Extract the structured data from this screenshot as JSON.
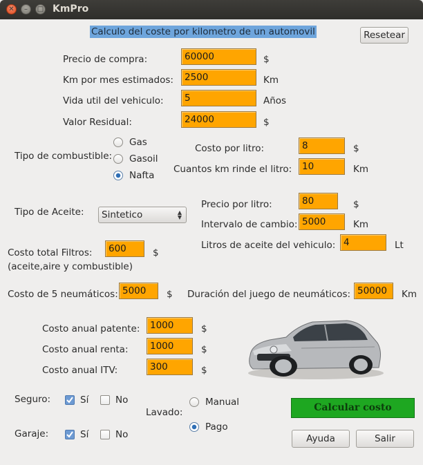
{
  "window": {
    "title": "KmPro"
  },
  "header": {
    "heading": "Calculo del coste por kilometro de un automovil",
    "reset_label": "Resetear"
  },
  "vehicle": {
    "precio_compra": {
      "label": "Precio de compra:",
      "value": "60000",
      "unit": "$"
    },
    "km_mes": {
      "label": "Km por mes estimados:",
      "value": "2500",
      "unit": "Km"
    },
    "vida_util": {
      "label": "Vida util del vehiculo:",
      "value": "5",
      "unit": "Años"
    },
    "valor_residual": {
      "label": "Valor Residual:",
      "value": "24000",
      "unit": "$"
    }
  },
  "fuel": {
    "label": "Tipo de combustible:",
    "options": [
      {
        "label": "Gas",
        "selected": false
      },
      {
        "label": "Gasoil",
        "selected": false
      },
      {
        "label": "Nafta",
        "selected": true
      }
    ],
    "costo_litro": {
      "label": "Costo por litro:",
      "value": "8",
      "unit": "$"
    },
    "km_litro": {
      "label": "Cuantos km rinde el litro:",
      "value": "10",
      "unit": "Km"
    }
  },
  "oil": {
    "label": "Tipo de Aceite:",
    "type_selected": "Sintetico",
    "precio_litro": {
      "label": "Precio por litro:",
      "value": "80",
      "unit": "$"
    },
    "intervalo": {
      "label": "Intervalo de cambio:",
      "value": "5000",
      "unit": "Km"
    },
    "litros": {
      "label": "Litros de aceite del vehiculo:",
      "value": "4",
      "unit": "Lt"
    }
  },
  "filters": {
    "label": "Costo total Filtros:",
    "sublabel": "(aceite,aire y combustible)",
    "value": "600",
    "unit": "$"
  },
  "tires": {
    "costo": {
      "label": "Costo de 5 neumáticos:",
      "value": "5000",
      "unit": "$"
    },
    "duracion": {
      "label": "Duración del juego de neumáticos:",
      "value": "50000",
      "unit": "Km"
    }
  },
  "annual": {
    "patente": {
      "label": "Costo anual patente:",
      "value": "1000",
      "unit": "$"
    },
    "renta": {
      "label": "Costo anual renta:",
      "value": "1000",
      "unit": "$"
    },
    "itv": {
      "label": "Costo anual ITV:",
      "value": "300",
      "unit": "$"
    }
  },
  "seguro": {
    "label": "Seguro:",
    "si": "Sí",
    "no": "No",
    "si_checked": true,
    "no_checked": false
  },
  "garaje": {
    "label": "Garaje:",
    "si": "Sí",
    "no": "No",
    "si_checked": true,
    "no_checked": false
  },
  "lavado": {
    "label": "Lavado:",
    "options": [
      {
        "label": "Manual",
        "selected": false
      },
      {
        "label": "Pago",
        "selected": true
      }
    ]
  },
  "actions": {
    "calcular": "Calcular costo",
    "ayuda": "Ayuda",
    "salir": "Salir"
  },
  "colors": {
    "field_bg": "#ffa500",
    "calc_bg": "#1ea721",
    "heading_bg": "#6ea5dc"
  }
}
